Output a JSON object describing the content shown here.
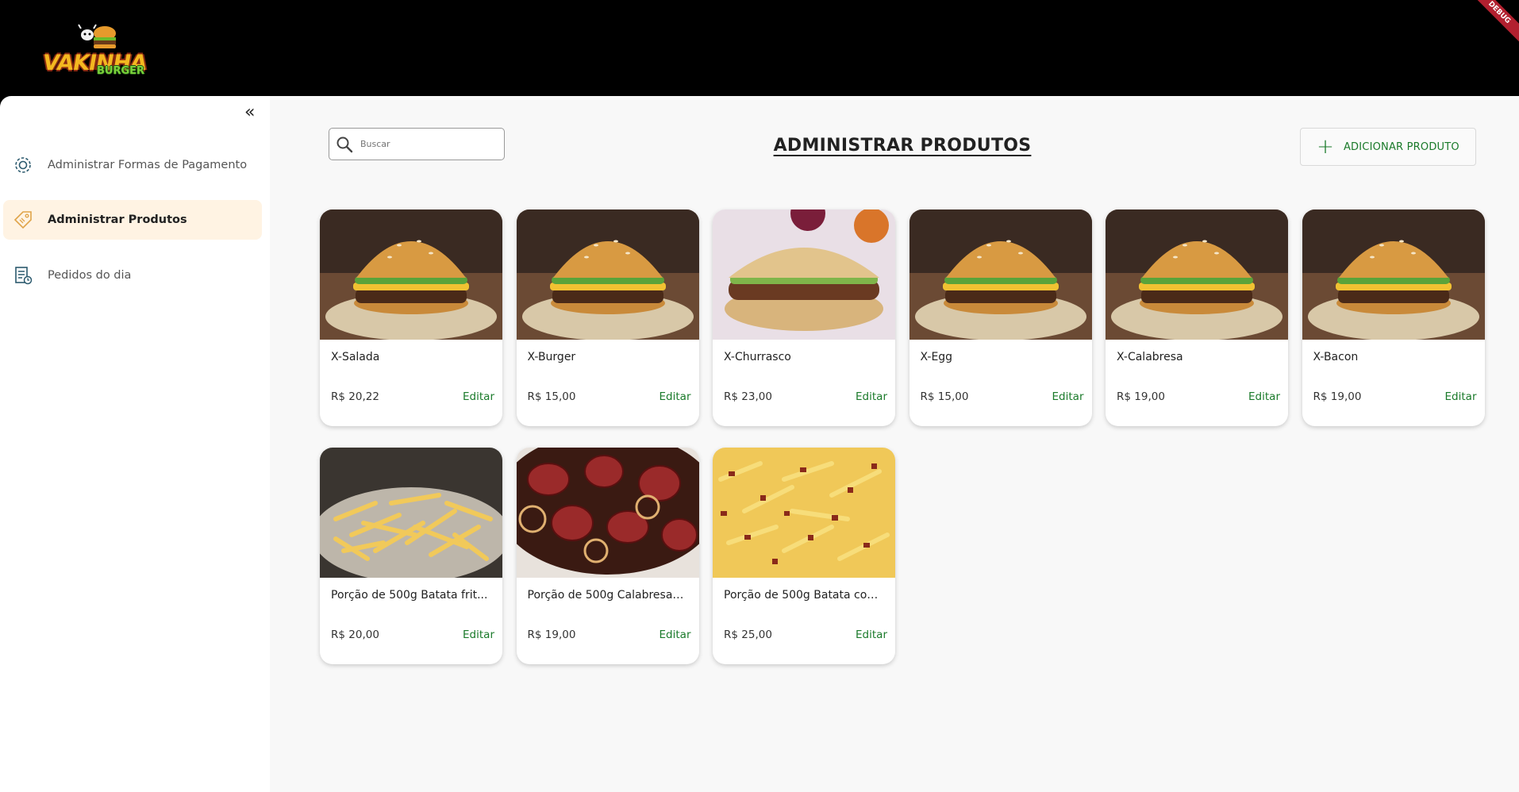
{
  "app": {
    "logo_word": "VAKINHA",
    "logo_sub": "BURGER",
    "debug_banner": "DEBUG"
  },
  "sidebar": {
    "items": [
      {
        "label": "Administrar Formas de Pagamento",
        "icon": "gear-icon"
      },
      {
        "label": "Administrar Produtos",
        "icon": "tag-icon"
      },
      {
        "label": "Pedidos do dia",
        "icon": "orders-icon"
      }
    ]
  },
  "toolbar": {
    "search_placeholder": "Buscar",
    "title": "ADMINISTRAR PRODUTOS",
    "add_label": "ADICIONAR PRODUTO"
  },
  "products": [
    {
      "name": "X-Salada",
      "price": "R$ 20,22",
      "edit": "Editar",
      "image": "burger"
    },
    {
      "name": "X-Burger",
      "price": "R$ 15,00",
      "edit": "Editar",
      "image": "burger"
    },
    {
      "name": "X-Churrasco",
      "price": "R$ 23,00",
      "edit": "Editar",
      "image": "sandwich"
    },
    {
      "name": "X-Egg",
      "price": "R$ 15,00",
      "edit": "Editar",
      "image": "burger"
    },
    {
      "name": "X-Calabresa",
      "price": "R$ 19,00",
      "edit": "Editar",
      "image": "burger"
    },
    {
      "name": "X-Bacon",
      "price": "R$ 19,00",
      "edit": "Editar",
      "image": "burger"
    },
    {
      "name": "Porção de 500g Batata frit...",
      "price": "R$ 20,00",
      "edit": "Editar",
      "image": "fries"
    },
    {
      "name": "Porção de 500g Calabresa ...",
      "price": "R$ 19,00",
      "edit": "Editar",
      "image": "sausage"
    },
    {
      "name": "Porção de 500g Batata com...",
      "price": "R$ 25,00",
      "edit": "Editar",
      "image": "fries-bacon"
    }
  ],
  "colors": {
    "accent_green": "#1a7a2a",
    "active_bg": "#fff3e3",
    "topbar": "#000000"
  }
}
